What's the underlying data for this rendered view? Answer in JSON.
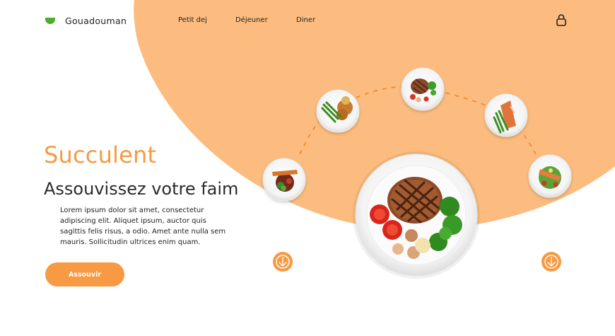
{
  "brand": {
    "name": "Gouadouman",
    "accent_color": "#f79a43",
    "arc_color": "#fcbc7f",
    "logo_color": "#4caf25"
  },
  "nav": {
    "items": [
      {
        "label": "Petit dej"
      },
      {
        "label": "Déjeuner"
      },
      {
        "label": "Diner"
      }
    ],
    "account_icon": "lock-icon"
  },
  "hero": {
    "title": "Succulent",
    "subtitle": "Assouvissez votre faim",
    "description": "Lorem ipsum dolor sit amet, consectetur adipiscing elit. Aliquet ipsum, auctor quis sagittis felis risus, a odio. Amet ante nulla sem mauris. Sollicitudin ultrices enim quam.",
    "cta_label": "Assouvir"
  },
  "carousel": {
    "featured_dish": "grilled-steak-plate",
    "dishes": [
      "salad-sweet-potato-plate",
      "chicken-green-beans-plate",
      "grilled-steak-small-plate",
      "salmon-asparagus-plate",
      "salmon-salad-plate"
    ],
    "prev_icon": "arrow-down-icon",
    "next_icon": "arrow-down-icon"
  }
}
